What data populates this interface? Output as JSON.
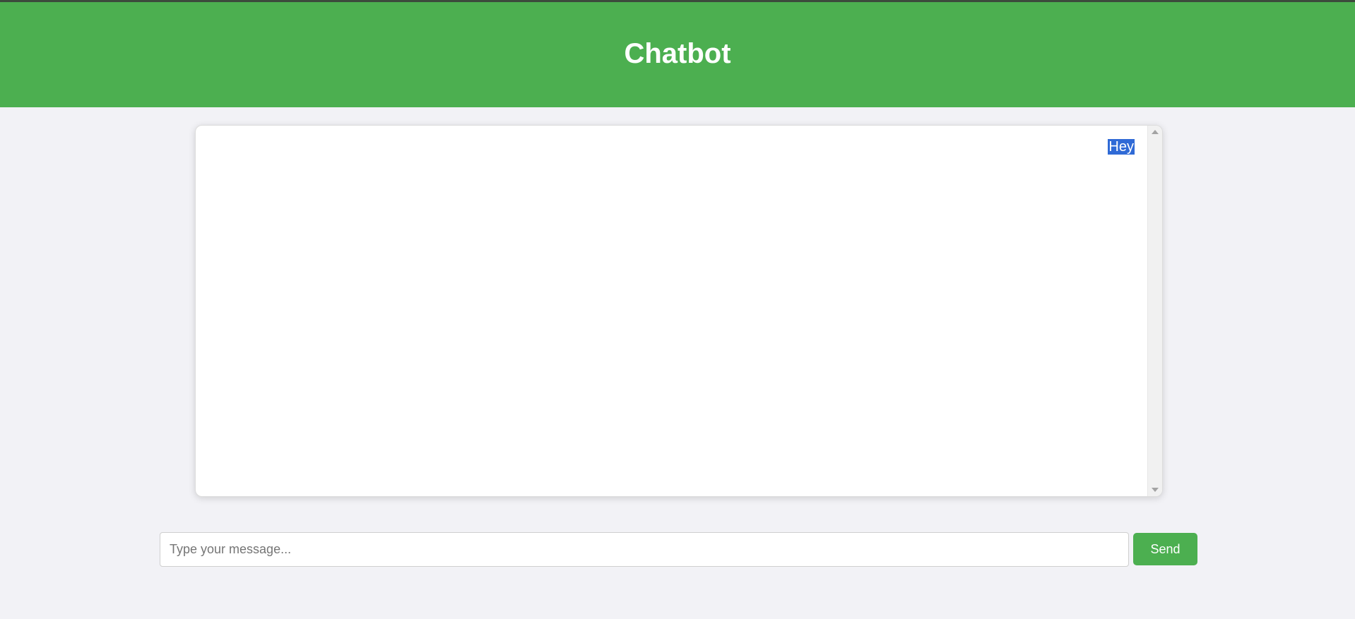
{
  "header": {
    "title": "Chatbot"
  },
  "chat": {
    "messages": [
      {
        "sender": "user",
        "text": "Hey"
      }
    ]
  },
  "composer": {
    "placeholder": "Type your message...",
    "value": "",
    "send_label": "Send"
  },
  "colors": {
    "header_bg": "#4caf50",
    "send_bg": "#4caf50",
    "selection_highlight": "#2f6ad6",
    "page_bg": "#f2f2f6"
  }
}
